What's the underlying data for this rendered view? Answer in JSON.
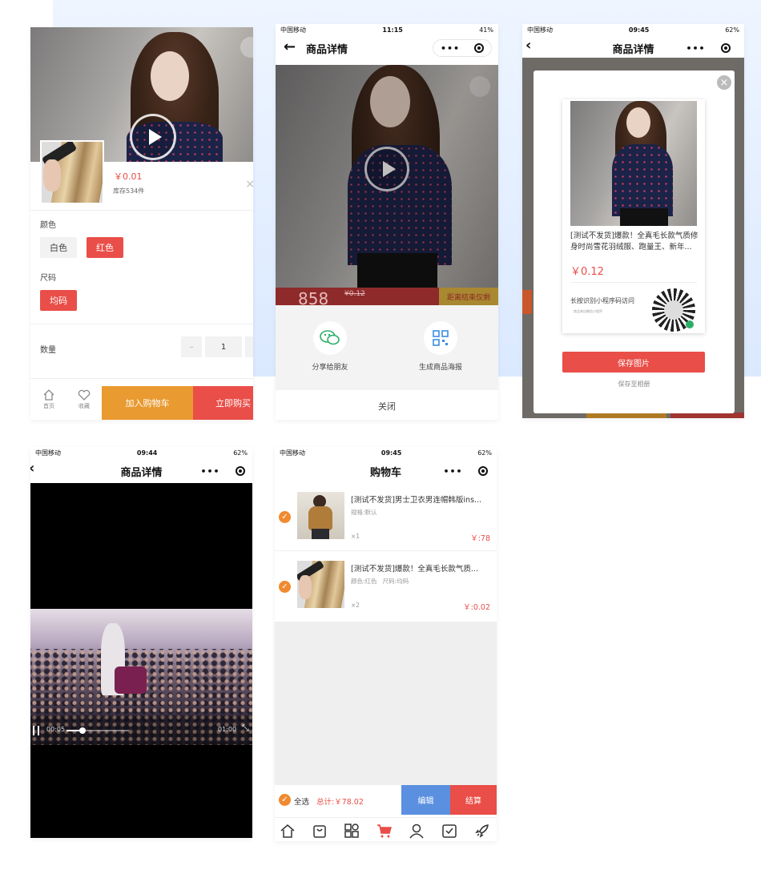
{
  "phone1": {
    "price": "￥0.01",
    "stock": "库存534件",
    "color_label": "颜色",
    "colors": [
      "白色",
      "红色"
    ],
    "size_label": "尺码",
    "sizes": [
      "均码"
    ],
    "qty_label": "数量",
    "qty_minus": "–",
    "qty_value": "1",
    "tab_home": "首页",
    "tab_fav": "收藏",
    "add_cart": "加入购物车",
    "buy_now": "立即购买",
    "close_icon": "×"
  },
  "phone2": {
    "status_carrier": "中国移动",
    "status_time": "11:15",
    "status_battery": "41%",
    "title": "商品详情",
    "capsule_dots": "•••",
    "price_strip_big": "858",
    "price_strip_old": "¥0.12",
    "countdown": "距离结束仅剩",
    "share_friends": "分享给朋友",
    "poster": "生成商品海报",
    "close": "关闭"
  },
  "phone3": {
    "status_carrier": "中国移动",
    "status_time": "09:45",
    "status_battery": "62%",
    "title": "商品详情",
    "capsule_dots": "•••",
    "poster_desc": "[测试不发货]爆款！全真毛长款气质修身时尚雪花羽绒服、跑量王、新年...",
    "poster_price": "￥0.12",
    "poster_hint": "长按识别小程序码访问",
    "poster_sub": "商品来自微信小程序",
    "save_image": "保存图片",
    "save_album": "保存至相册"
  },
  "phone4": {
    "status_carrier": "中国移动",
    "status_time": "09:44",
    "status_battery": "62%",
    "title": "商品详情",
    "capsule_dots": "•••",
    "time_current": "00:05",
    "time_total": "01:00",
    "video_progress": 0.25
  },
  "phone5": {
    "status_carrier": "中国移动",
    "status_time": "09:45",
    "status_battery": "62%",
    "title": "购物车",
    "capsule_dots": "•••",
    "items": [
      {
        "title": "[测试不发货]男士卫衣男连帽韩版ins...",
        "spec": "规格:默认",
        "qty": "×1",
        "price": "￥:78"
      },
      {
        "title": "[测试不发货]爆款！全真毛长款气质...",
        "spec": "颜色:红色   尺码:均码",
        "qty": "×2",
        "price": "￥:0.02"
      }
    ],
    "select_all": "全选",
    "total": "总计:￥78.02",
    "edit": "编辑",
    "checkout": "结算",
    "check": "✓"
  },
  "colors": {
    "red": "#e94e48",
    "orange": "#e99a30",
    "blue": "#5b90e0",
    "check": "#f08a30"
  }
}
